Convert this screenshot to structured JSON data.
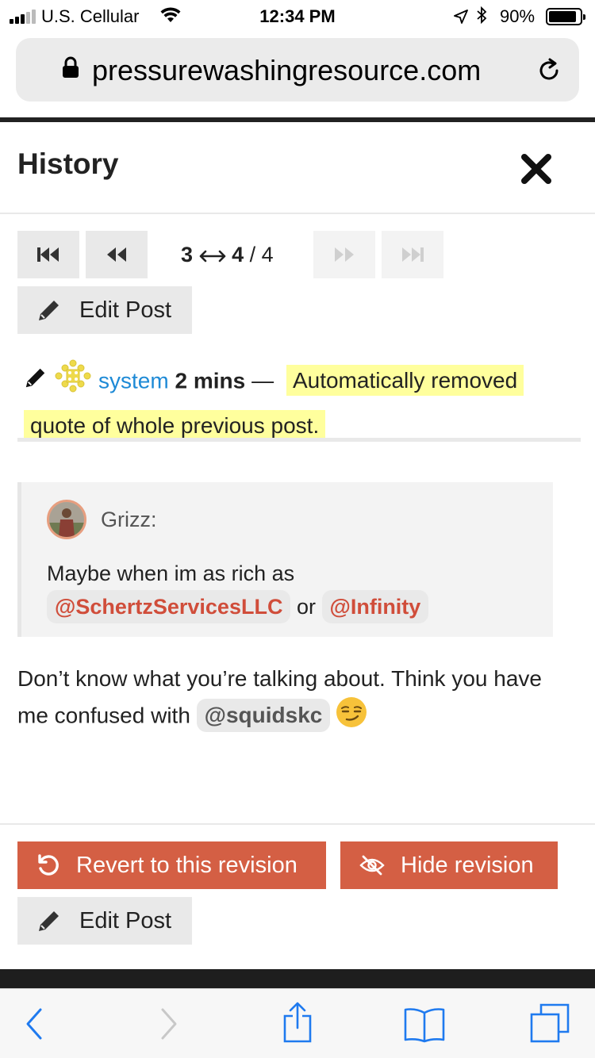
{
  "status_bar": {
    "carrier": "U.S. Cellular",
    "time": "12:34 PM",
    "battery_percent": "90%",
    "battery_level": 0.9
  },
  "browser": {
    "url": "pressurewashingresource.com"
  },
  "modal": {
    "title": "History",
    "revision_from": "3",
    "revision_to": "4",
    "revision_total": "/ 4",
    "edit_post_label": "Edit Post",
    "revision_meta": {
      "username": "system",
      "time_ago": "2 mins",
      "dash": "—",
      "reason": "Automatically removed quote of whole previous post."
    }
  },
  "post": {
    "quote": {
      "author": "Grizz:",
      "text": "Maybe when im as rich as",
      "mention_1": "@SchertzServicesLLC",
      "connector": "or",
      "mention_2": "@Infinity"
    },
    "body_text": "Don’t know what you’re talking about. Think you have me confused with",
    "body_mention": "@squidskc"
  },
  "actions": {
    "revert_label": "Revert to this revision",
    "hide_label": "Hide revision",
    "edit_post_label": "Edit Post"
  },
  "colors": {
    "accent_red": "#d45f44",
    "link_blue": "#1e8ad6",
    "highlight_yellow": "#ffff9d",
    "safari_blue": "#1f7aef"
  }
}
